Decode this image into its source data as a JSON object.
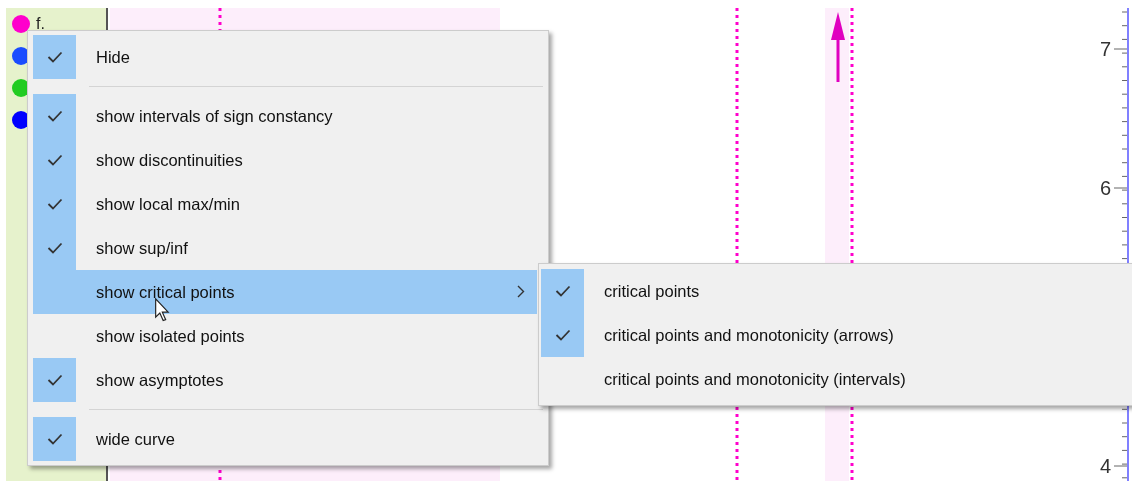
{
  "functions": [
    {
      "color": "#ff00cc",
      "label": "f."
    },
    {
      "color": "#1a4cff"
    },
    {
      "color": "#22cc22"
    },
    {
      "color": "#0000ff"
    }
  ],
  "plot": {
    "yticks": [
      "7",
      "6",
      "4"
    ]
  },
  "menu": {
    "items": [
      {
        "kind": "check",
        "label": "Hide",
        "checked": true,
        "selected": false
      },
      {
        "kind": "separator"
      },
      {
        "kind": "check",
        "label": "show intervals of sign constancy",
        "checked": true,
        "selected": false
      },
      {
        "kind": "check",
        "label": "show discontinuities",
        "checked": true,
        "selected": false
      },
      {
        "kind": "check",
        "label": "show local max/min",
        "checked": true,
        "selected": false
      },
      {
        "kind": "check",
        "label": "show sup/inf",
        "checked": true,
        "selected": false
      },
      {
        "kind": "submenu",
        "label": "show critical points",
        "checked": false,
        "selected": true
      },
      {
        "kind": "check",
        "label": "show isolated points",
        "checked": false,
        "selected": false
      },
      {
        "kind": "check",
        "label": "show asymptotes",
        "checked": true,
        "selected": false
      },
      {
        "kind": "separator"
      },
      {
        "kind": "check",
        "label": "wide curve",
        "checked": true,
        "selected": false
      }
    ]
  },
  "submenu": {
    "items": [
      {
        "label": "critical points",
        "checked": true
      },
      {
        "label": "critical points and monotonicity (arrows)",
        "checked": true
      },
      {
        "label": "critical points and monotonicity (intervals)",
        "checked": false
      }
    ]
  }
}
